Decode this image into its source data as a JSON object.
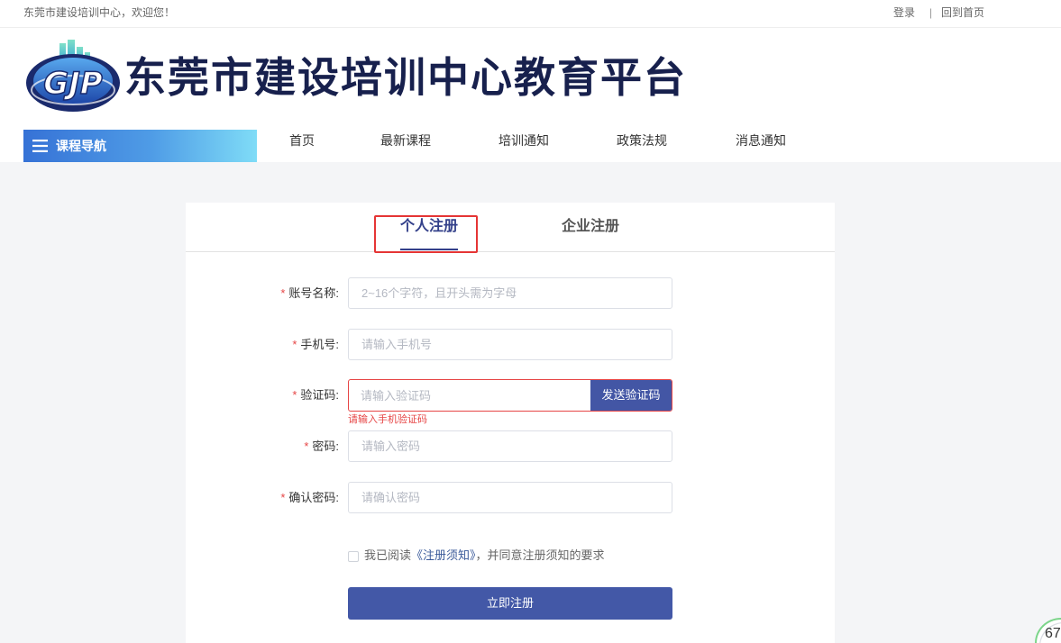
{
  "topbar": {
    "welcome": "东莞市建设培训中心，欢迎您！",
    "login": "登录",
    "separator": "|",
    "home": "回到首页"
  },
  "header": {
    "logo_text": "GJP",
    "title": "东莞市建设培训中心教育平台"
  },
  "nav": {
    "category_label": "课程导航",
    "category_icon": "menu-icon",
    "items": [
      {
        "label": "首页"
      },
      {
        "label": "最新课程"
      },
      {
        "label": "培训通知"
      },
      {
        "label": "政策法规"
      },
      {
        "label": "消息通知"
      }
    ]
  },
  "tabs": [
    {
      "label": "个人注册",
      "active": true
    },
    {
      "label": "企业注册",
      "active": false
    }
  ],
  "form": {
    "required_mark": "*",
    "fields": [
      {
        "label": "账号名称:",
        "placeholder": "2~16个字符，且开头需为字母",
        "value": ""
      },
      {
        "label": "手机号:",
        "placeholder": "请输入手机号",
        "value": ""
      },
      {
        "label": "验证码:",
        "placeholder": "请输入验证码",
        "value": ""
      },
      {
        "label": "密码:",
        "placeholder": "请输入密码",
        "value": ""
      },
      {
        "label": "确认密码:",
        "placeholder": "请确认密码",
        "value": ""
      }
    ],
    "send_code_label": "发送验证码",
    "code_error": "请输入手机验证码",
    "agreement": {
      "checked": false,
      "prefix": "我已阅读",
      "link": "《注册须知》",
      "suffix": "，并同意注册须知的要求"
    },
    "submit_label": "立即注册"
  },
  "badge": {
    "text": "67"
  },
  "colors": {
    "title": "#17204d",
    "accent": "#4358a7",
    "active_tab": "#33408a",
    "error": "#e64545",
    "highlight": "#e53535",
    "nav_gradient_start": "#3672d6",
    "nav_gradient_end": "#7fdcf7",
    "page_background": "#f4f5f7"
  }
}
